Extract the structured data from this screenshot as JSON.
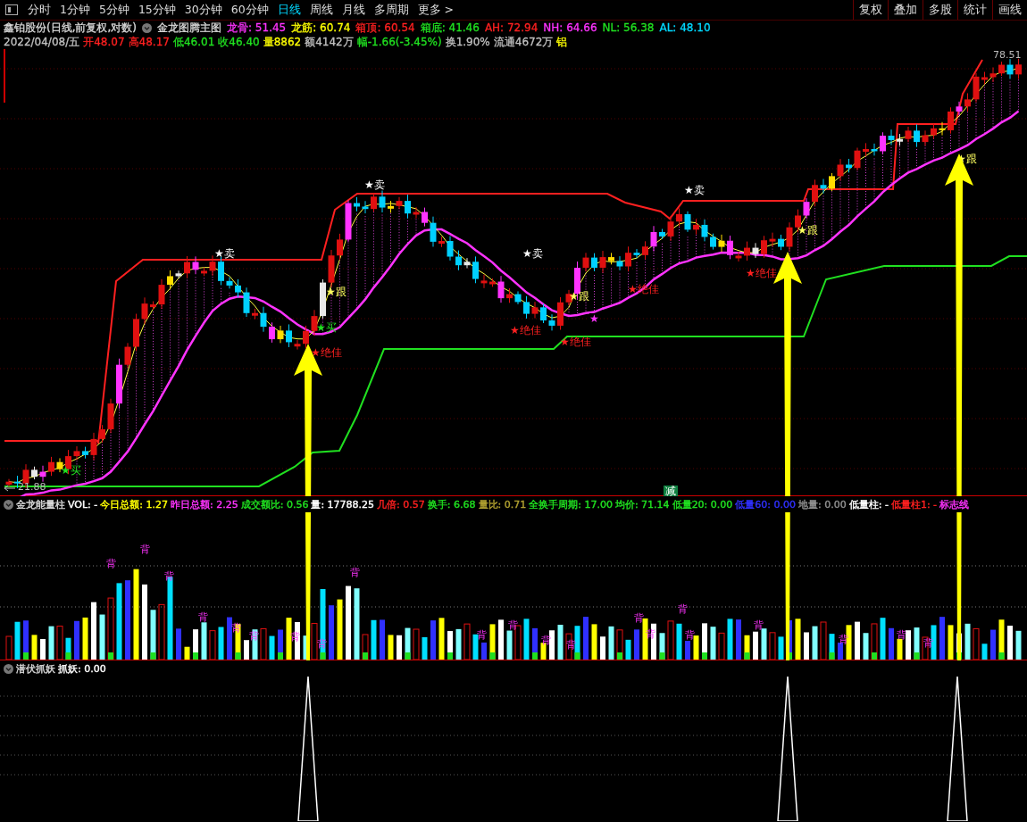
{
  "toolbar": {
    "tabs": [
      {
        "label": "分时",
        "selected": false
      },
      {
        "label": "1分钟",
        "selected": false
      },
      {
        "label": "5分钟",
        "selected": false
      },
      {
        "label": "15分钟",
        "selected": false
      },
      {
        "label": "30分钟",
        "selected": false
      },
      {
        "label": "60分钟",
        "selected": false
      },
      {
        "label": "日线",
        "selected": true
      },
      {
        "label": "周线",
        "selected": false
      },
      {
        "label": "月线",
        "selected": false
      },
      {
        "label": "多周期",
        "selected": false
      },
      {
        "label": "更多 >",
        "selected": false
      }
    ],
    "buttons": [
      "复权",
      "叠加",
      "多股",
      "统计",
      "画线"
    ]
  },
  "header": {
    "title": "鑫铂股份(日线,前复权,对数)",
    "indicator": "金龙图腾主图",
    "values": [
      {
        "label": "龙骨: 51.45",
        "color": "#ff33ff"
      },
      {
        "label": "龙筋: 60.74",
        "color": "#ffff00"
      },
      {
        "label": "箱顶: 60.54",
        "color": "#ff2020"
      },
      {
        "label": "箱底: 41.46",
        "color": "#20e020"
      },
      {
        "label": "AH: 72.94",
        "color": "#ff2020"
      },
      {
        "label": "NH: 64.66",
        "color": "#ff33ff"
      },
      {
        "label": "NL: 56.38",
        "color": "#20e020"
      },
      {
        "label": "AL: 48.10",
        "color": "#00d8ff"
      }
    ]
  },
  "quote": {
    "date": "2022/04/08/五",
    "values": [
      {
        "label": "开48.07",
        "color": "#ff2020"
      },
      {
        "label": "高48.17",
        "color": "#ff2020"
      },
      {
        "label": "低46.01",
        "color": "#20e020"
      },
      {
        "label": "收46.40",
        "color": "#20e020"
      },
      {
        "label": "量8862",
        "color": "#ffff00"
      },
      {
        "label": "额4142万",
        "color": "#c0c0c0"
      },
      {
        "label": "幅-1.66(-3.45%)",
        "color": "#20e020"
      },
      {
        "label": "换1.90%",
        "color": "#c0c0c0"
      },
      {
        "label": "流通4672万",
        "color": "#c0c0c0"
      },
      {
        "label": "铝",
        "color": "#ffff00"
      }
    ]
  },
  "main_chart": {
    "high_label": "78.51",
    "low_label": "21.88",
    "signals": [
      {
        "text": "★买",
        "kind": "buy"
      },
      {
        "text": "★卖",
        "kind": "sell"
      },
      {
        "text": "★买",
        "kind": "buy"
      },
      {
        "text": "★跟",
        "kind": "follow"
      },
      {
        "text": "★绝佳",
        "kind": "best"
      },
      {
        "text": "★卖",
        "kind": "sell"
      },
      {
        "text": "★卖",
        "kind": "sell"
      },
      {
        "text": "★绝佳",
        "kind": "best"
      },
      {
        "text": "★跟",
        "kind": "follow"
      },
      {
        "text": "★",
        "kind": "star"
      },
      {
        "text": "★绝佳",
        "kind": "best"
      },
      {
        "text": "★绝佳",
        "kind": "best"
      },
      {
        "text": "★卖",
        "kind": "sell"
      },
      {
        "text": "★绝佳",
        "kind": "best"
      },
      {
        "text": "★跟",
        "kind": "follow"
      },
      {
        "text": "★跟",
        "kind": "follow"
      },
      {
        "text": "减",
        "kind": "reduce"
      }
    ]
  },
  "volume_panel": {
    "title": "金龙能量柱",
    "values": [
      {
        "label": "VOL: -",
        "color": "#ffffff"
      },
      {
        "label": "今日总额: 1.27",
        "color": "#ffff00"
      },
      {
        "label": "昨日总额: 2.25",
        "color": "#ff33ff"
      },
      {
        "label": "成交额比: 0.56",
        "color": "#20e020"
      },
      {
        "label": "量: 17788.25",
        "color": "#ffffff"
      },
      {
        "label": "几倍: 0.57",
        "color": "#ff2020"
      },
      {
        "label": "换手: 6.68",
        "color": "#20e020"
      },
      {
        "label": "量比: 0.71",
        "color": "#b0a030"
      },
      {
        "label": "全换手周期: 17.00",
        "color": "#20e020"
      },
      {
        "label": "均价: 71.14",
        "color": "#20e020"
      },
      {
        "label": "低量20: 0.00",
        "color": "#20e020"
      },
      {
        "label": "低量60: 0.00",
        "color": "#3030ff"
      },
      {
        "label": "地量: 0.00",
        "color": "#909090"
      },
      {
        "label": "低量柱: -",
        "color": "#ffffff"
      },
      {
        "label": "低量柱1: -",
        "color": "#ff2020"
      },
      {
        "label": "标志线",
        "color": "#ff33ff"
      }
    ],
    "marks": [
      "背",
      "背",
      "背",
      "背",
      "背",
      "背",
      "背",
      "背",
      "背",
      "背",
      "背",
      "背",
      "背",
      "背",
      "背",
      "背",
      "背",
      "背",
      "背",
      "背",
      "背"
    ]
  },
  "bottom_panel": {
    "title": "潜伏抓妖",
    "values": [
      {
        "label": "抓妖: 0.00",
        "color": "#ffffff"
      }
    ]
  }
}
